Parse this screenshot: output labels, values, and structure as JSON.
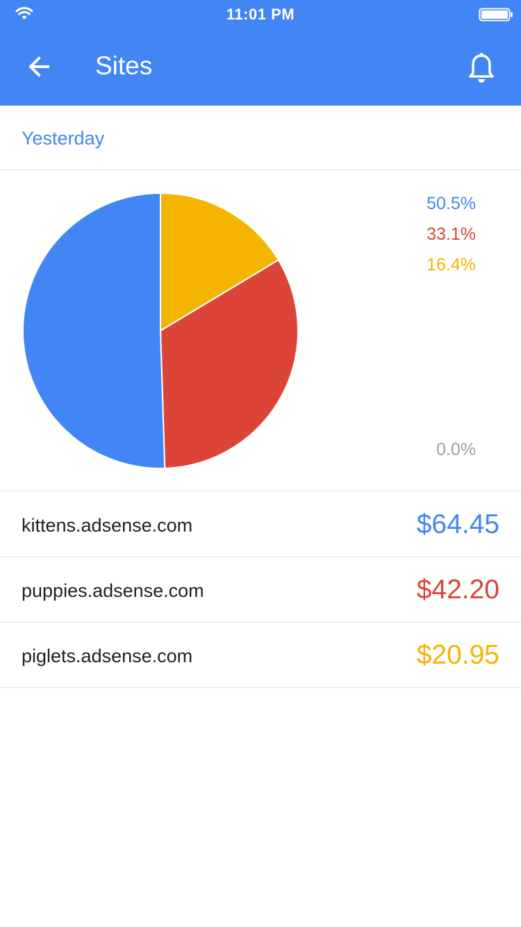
{
  "status_bar": {
    "time": "11:01 PM"
  },
  "toolbar": {
    "title": "Sites",
    "back_icon": "arrow-back-icon",
    "notifications_icon": "bell-icon"
  },
  "period": {
    "label": "Yesterday"
  },
  "colors": {
    "primary": "#4285f4",
    "red": "#db4437",
    "yellow": "#f4b400",
    "gray": "#9e9e9e"
  },
  "chart_data": {
    "type": "pie",
    "slices": [
      {
        "site": "kittens.adsense.com",
        "value": 50.5,
        "label": "50.5%",
        "color": "#4285f4"
      },
      {
        "site": "puppies.adsense.com",
        "value": 33.1,
        "label": "33.1%",
        "color": "#db4437"
      },
      {
        "site": "piglets.adsense.com",
        "value": 16.4,
        "label": "16.4%",
        "color": "#f4b400"
      }
    ],
    "other_label": "0.0%"
  },
  "sites": [
    {
      "name": "kittens.adsense.com",
      "amount": "$64.45",
      "color": "#4285f4"
    },
    {
      "name": "puppies.adsense.com",
      "amount": "$42.20",
      "color": "#db4437"
    },
    {
      "name": "piglets.adsense.com",
      "amount": "$20.95",
      "color": "#f4b400"
    }
  ]
}
